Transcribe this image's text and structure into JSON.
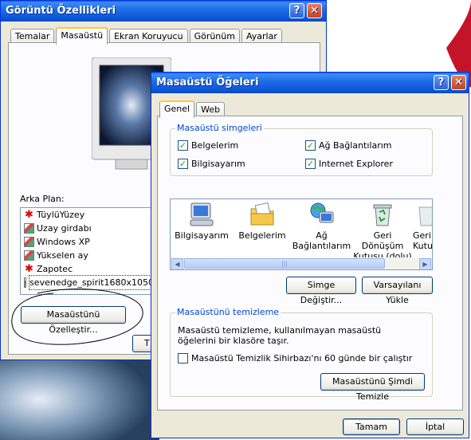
{
  "display_props": {
    "title": "Görüntü Özellikleri",
    "help_btn": "?",
    "close_btn": "✕",
    "tabs": [
      "Temalar",
      "Masaüstü",
      "Ekran Koruyucu",
      "Görünüm",
      "Ayarlar"
    ],
    "active_tab": "Masaüstü",
    "background_label": "Arka Plan:",
    "backgrounds": [
      {
        "name": "TüylüYüzey",
        "icon": "splat-icon"
      },
      {
        "name": "Uzay girdabı",
        "icon": "image-icon"
      },
      {
        "name": "Windows XP",
        "icon": "image-icon"
      },
      {
        "name": "Yükselen ay",
        "icon": "image-icon"
      },
      {
        "name": "Zapotec",
        "icon": "splat-icon"
      },
      {
        "name": "sevenedge_spirit1680x1050",
        "icon": "image-icon"
      }
    ],
    "customize_button": "Masaüstünü Özelleştir...",
    "partial_button": "T"
  },
  "desktop_items": {
    "title": "Masaüstü Öğeleri",
    "help_btn": "?",
    "close_btn": "✕",
    "tabs": [
      "Genel",
      "Web"
    ],
    "active_tab": "Genel",
    "icons_group": {
      "label": "Masaüstü simgeleri",
      "checkboxes": [
        {
          "label": "Belgelerim",
          "checked": true
        },
        {
          "label": "Ağ Bağlantılarım",
          "checked": true
        },
        {
          "label": "Bilgisayarım",
          "checked": true
        },
        {
          "label": "Internet Explorer",
          "checked": true
        }
      ]
    },
    "icon_list": [
      {
        "label": "Bilgisayarım",
        "label2": "",
        "icon": "computer-icon"
      },
      {
        "label": "Belgelerim",
        "label2": "",
        "icon": "documents-folder-icon"
      },
      {
        "label": "Ağ",
        "label2": "Bağlantılarım",
        "icon": "network-icon"
      },
      {
        "label": "Geri Dönüşüm",
        "label2": "Kutusu (dolu)",
        "icon": "recycle-bin-icon"
      },
      {
        "label": "Geri",
        "label2": "Kutu",
        "icon": "recycle-bin-icon"
      }
    ],
    "change_icon_button": "Simge Değiştir...",
    "restore_default_button": "Varsayılanı Yükle",
    "cleanup_group": {
      "label": "Masaüstünü temizleme",
      "description": "Masaüstü temizleme, kullanılmayan masaüstü öğelerini bir klasöre taşır.",
      "checkbox_label": "Masaüstü Temizlik Sihirbazı'nı 60 günde bir çalıştır",
      "checkbox_checked": false,
      "cleanup_button": "Masaüstünü Şimdi Temizle"
    },
    "ok_button": "Tamam",
    "cancel_button": "İptal"
  }
}
